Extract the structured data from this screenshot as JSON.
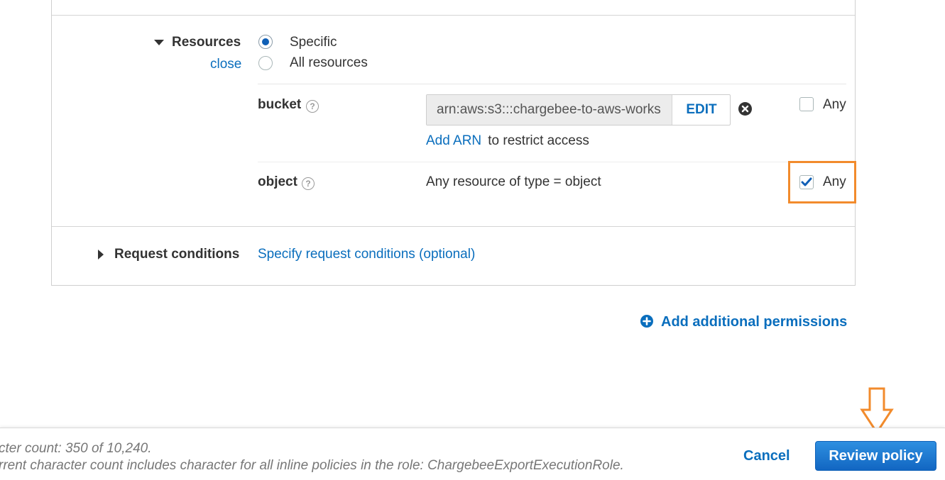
{
  "resources": {
    "label": "Resources",
    "close_link": "close",
    "option_specific": "Specific",
    "option_all": "All resources",
    "selected": "Specific"
  },
  "bucket": {
    "label": "bucket",
    "arn_value": "arn:aws:s3:::chargebee-to-aws-works",
    "edit_label": "EDIT",
    "add_arn_link": "Add ARN",
    "add_arn_suffix": " to restrict access",
    "any_label": "Any",
    "any_checked": false
  },
  "object": {
    "label": "object",
    "description": "Any resource of type = object",
    "any_label": "Any",
    "any_checked": true
  },
  "request_conditions": {
    "label": "Request conditions",
    "link": "Specify request conditions (optional)"
  },
  "add_permissions": "Add additional permissions",
  "footer": {
    "char_count": "cter count: 350 of 10,240.",
    "char_note": "rrent character count includes character for all inline policies in the role: ChargebeeExportExecutionRole.",
    "cancel": "Cancel",
    "review": "Review policy"
  },
  "colors": {
    "accent": "#0a6ebd",
    "primary_button": "#1a73cf",
    "highlight": "#f28b2c"
  }
}
